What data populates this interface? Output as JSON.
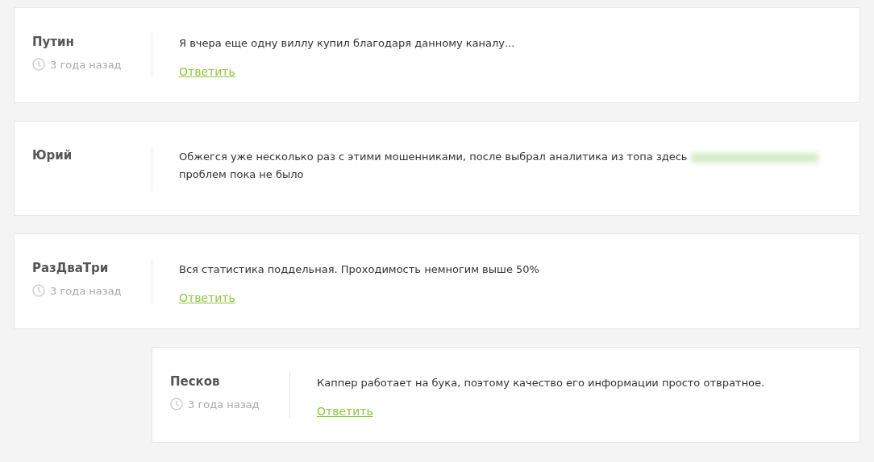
{
  "comments": [
    {
      "author": "Путин",
      "time": "3 года назад",
      "text": "Я вчера еще одну виллу купил благодаря данному каналу...",
      "reply": "Ответить"
    },
    {
      "author": "Юрий",
      "text": "Обжегся уже несколько раз с этими мошенниками, после выбрал аналитика из топа здесь",
      "link_redacted": true,
      "after_link": "проблем пока не было"
    },
    {
      "author": "РазДваТри",
      "time": "3 года назад",
      "text": "Вся статистика поддельная. Проходимость немногим выше 50%",
      "reply": "Ответить",
      "children": [
        {
          "author": "Песков",
          "time": "3 года назад",
          "text": "Каппер работает на бука, поэтому качество его информации просто отвратное.",
          "reply": "Ответить"
        }
      ]
    }
  ]
}
